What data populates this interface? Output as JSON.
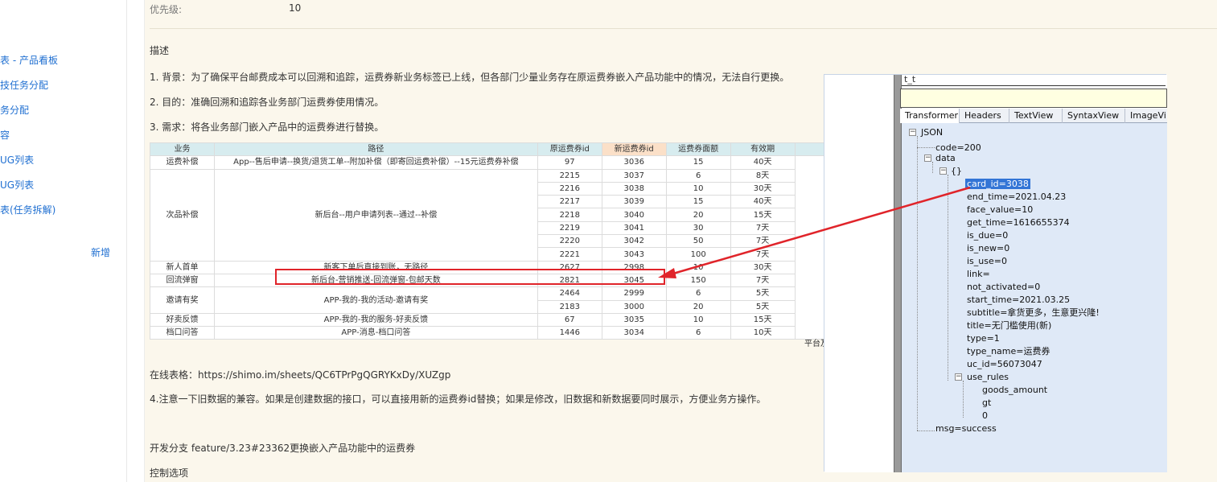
{
  "sidebar": {
    "items": [
      "表 - 产品看板",
      "技任务分配",
      "务分配",
      "容",
      "UG列表",
      "UG列表",
      "表(任务拆解)"
    ],
    "add_label": "新增"
  },
  "main": {
    "priority_label": "优先级:",
    "priority_value": "10",
    "desc_heading": "描述",
    "para1": "1. 背景：为了确保平台邮费成本可以回溯和追踪，运费券新业务标签已上线，但各部门少量业务存在原运费券嵌入产品功能中的情况，无法自行更换。",
    "para2": "2. 目的：准确回溯和追踪各业务部门运费券使用情况。",
    "para3": "3. 需求：将各业务部门嵌入产品中的运费券进行替换。",
    "online_sheet": "在线表格：https://shimo.im/sheets/QC6TPrPgQGRYKxDy/XUZgp",
    "note4": "4.注意一下旧数据的兼容。如果是创建数据的接口，可以直接用新的运费券id替换；如果是修改，旧数据和新数据要同时展示，方便业务方操作。",
    "branch": "开发分支  feature/3.23#23362更换嵌入产品功能中的运费券",
    "control_options": "控制选项"
  },
  "table": {
    "headers": [
      "业务",
      "路径",
      "原运费券id",
      "新运费券id",
      "运费券面额",
      "有效期"
    ],
    "rows": [
      {
        "biz": "运费补偿",
        "route": "App--售后申请--换货/退货工单--附加补偿（即寄回运费补偿）--15元运费券补偿",
        "old": "97",
        "new": "3036",
        "amount": "15",
        "valid": "40天"
      },
      {
        "biz": "次品补偿",
        "route": "新后台--用户申请列表--通过--补偿",
        "old": "2215",
        "new": "3037",
        "amount": "6",
        "valid": "8天"
      },
      {
        "old": "2216",
        "new": "3038",
        "amount": "10",
        "valid": "30天"
      },
      {
        "old": "2217",
        "new": "3039",
        "amount": "15",
        "valid": "40天"
      },
      {
        "old": "2218",
        "new": "3040",
        "amount": "20",
        "valid": "15天"
      },
      {
        "old": "2219",
        "new": "3041",
        "amount": "30",
        "valid": "7天"
      },
      {
        "old": "2220",
        "new": "3042",
        "amount": "50",
        "valid": "7天"
      },
      {
        "old": "2221",
        "new": "3043",
        "amount": "100",
        "valid": "7天"
      },
      {
        "biz": "新人首单",
        "route": "新客下单后直接到账，无路径",
        "old": "2627",
        "new": "2998",
        "amount": "10",
        "valid": "30天"
      },
      {
        "biz": "回流弹窗",
        "route": "新后台-营销推送-回流弹窗-包邮天数",
        "old": "2821",
        "new": "3045",
        "amount": "150",
        "valid": "7天"
      },
      {
        "biz": "邀请有奖",
        "route": "APP-我的-我的活动-邀请有奖",
        "old": "2464",
        "new": "2999",
        "amount": "6",
        "valid": "5天"
      },
      {
        "old": "2183",
        "new": "3000",
        "amount": "20",
        "valid": "5天"
      },
      {
        "biz": "好卖反馈",
        "route": "APP-我的-我的服务-好卖反馈",
        "old": "67",
        "new": "3035",
        "amount": "10",
        "valid": "15天"
      },
      {
        "biz": "档口问答",
        "route": "APP-消息-档口问答",
        "old": "1446",
        "new": "3034",
        "amount": "6",
        "valid": "10天"
      }
    ],
    "side_note": "平台及"
  },
  "fiddler": {
    "top_field": "t_t",
    "tabs": [
      "Transformer",
      "Headers",
      "TextView",
      "SyntaxView",
      "ImageVi"
    ],
    "tree": {
      "root": "JSON",
      "code": "code=200",
      "data": "data",
      "obj": "{}",
      "fields": [
        "card_id=3038",
        "end_time=2021.04.23",
        "face_value=10",
        "get_time=1616655374",
        "is_due=0",
        "is_new=0",
        "is_use=0",
        "link=",
        "not_activated=0",
        "start_time=2021.03.25",
        "subtitle=拿货更多，生意更兴隆!",
        "title=无门槛使用(新)",
        "type=1",
        "type_name=运费券",
        "uc_id=56073047"
      ],
      "use_rules": "use_rules",
      "rule_items": [
        "goods_amount",
        "gt",
        "0"
      ],
      "msg": "msg=success"
    }
  },
  "colors": {
    "panel_bg": "#fbf7ec",
    "link_blue": "#1f6fd1",
    "annotation_red": "#e0242a",
    "selection_blue": "#3375d6",
    "tree_bg": "#dfe9f7"
  }
}
